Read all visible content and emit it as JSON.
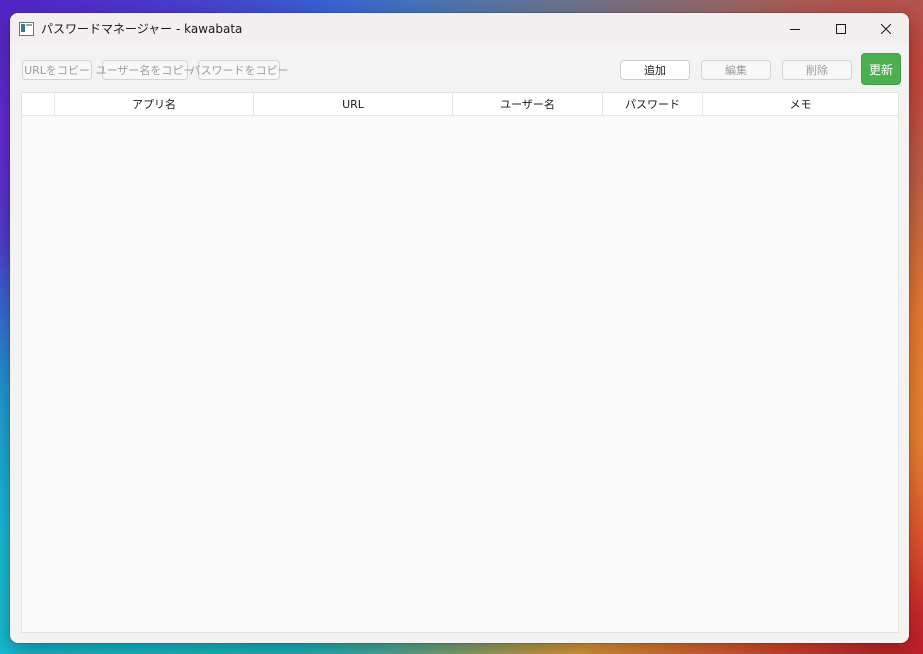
{
  "window": {
    "title": "パスワードマネージャー - kawabata",
    "controls": {
      "minimize": "minimize-icon",
      "maximize": "maximize-icon",
      "close": "close-icon"
    }
  },
  "toolbar": {
    "copy_url": "URLをコピー",
    "copy_username": "ユーザー名をコピー",
    "copy_password": "パスワードをコピー",
    "add": "追加",
    "edit": "編集",
    "delete": "削除",
    "refresh": "更新"
  },
  "table": {
    "columns": [
      "",
      "アプリ名",
      "URL",
      "ユーザー名",
      "パスワード",
      "メモ"
    ],
    "rows": []
  },
  "colors": {
    "primary_button": "#4caf50",
    "window_bg": "#f3f3f3",
    "table_bg": "#fafafa"
  }
}
